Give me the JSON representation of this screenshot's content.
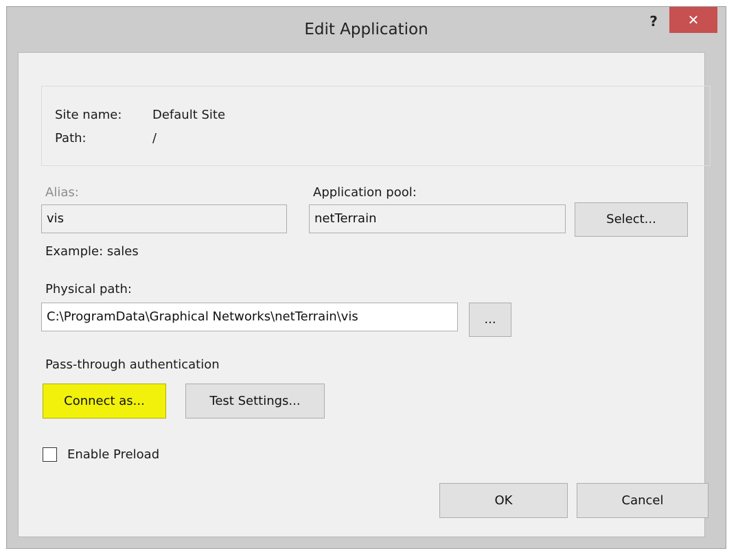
{
  "dialog": {
    "title": "Edit Application",
    "help_label": "?",
    "close_label": "✕"
  },
  "site_info": {
    "site_name_label": "Site name:",
    "site_name_value": "Default Site",
    "path_label": "Path:",
    "path_value": "/"
  },
  "alias": {
    "label": "Alias:",
    "value": "vis",
    "example": "Example: sales"
  },
  "app_pool": {
    "label": "Application pool:",
    "value": "netTerrain",
    "select_button": "Select..."
  },
  "physical_path": {
    "label": "Physical path:",
    "value": "C:\\ProgramData\\Graphical Networks\\netTerrain\\vis",
    "browse_button": "..."
  },
  "auth": {
    "label": "Pass-through authentication",
    "connect_button": "Connect as...",
    "test_button": "Test Settings..."
  },
  "preload": {
    "label": "Enable Preload",
    "checked": false
  },
  "footer": {
    "ok_button": "OK",
    "cancel_button": "Cancel"
  },
  "colors": {
    "frame": "#cccccc",
    "client": "#f0f0f0",
    "close_button": "#c75050",
    "highlight": "#f1f10c"
  }
}
